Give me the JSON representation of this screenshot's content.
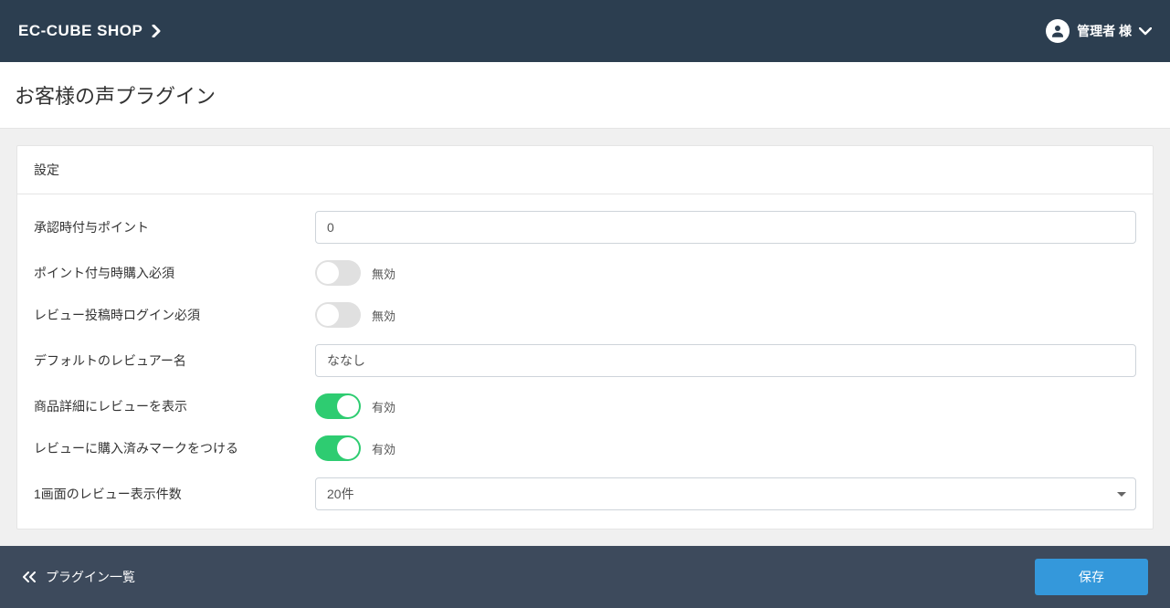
{
  "header": {
    "brand": "EC-CUBE SHOP",
    "user_name": "管理者 様"
  },
  "page": {
    "title": "お客様の声プラグイン"
  },
  "card": {
    "title": "設定"
  },
  "form": {
    "point_on_approve": {
      "label": "承認時付与ポイント",
      "value": "0"
    },
    "require_purchase_for_point": {
      "label": "ポイント付与時購入必須",
      "state": "off",
      "state_label": "無効"
    },
    "require_login_for_review": {
      "label": "レビュー投稿時ログイン必須",
      "state": "off",
      "state_label": "無効"
    },
    "default_reviewer_name": {
      "label": "デフォルトのレビュアー名",
      "value": "ななし"
    },
    "show_review_on_product": {
      "label": "商品詳細にレビューを表示",
      "state": "on",
      "state_label": "有効"
    },
    "mark_purchased_on_review": {
      "label": "レビューに購入済みマークをつける",
      "state": "on",
      "state_label": "有効"
    },
    "reviews_per_page": {
      "label": "1画面のレビュー表示件数",
      "value": "20件"
    }
  },
  "footer": {
    "back_label": "プラグイン一覧",
    "save_label": "保存"
  }
}
